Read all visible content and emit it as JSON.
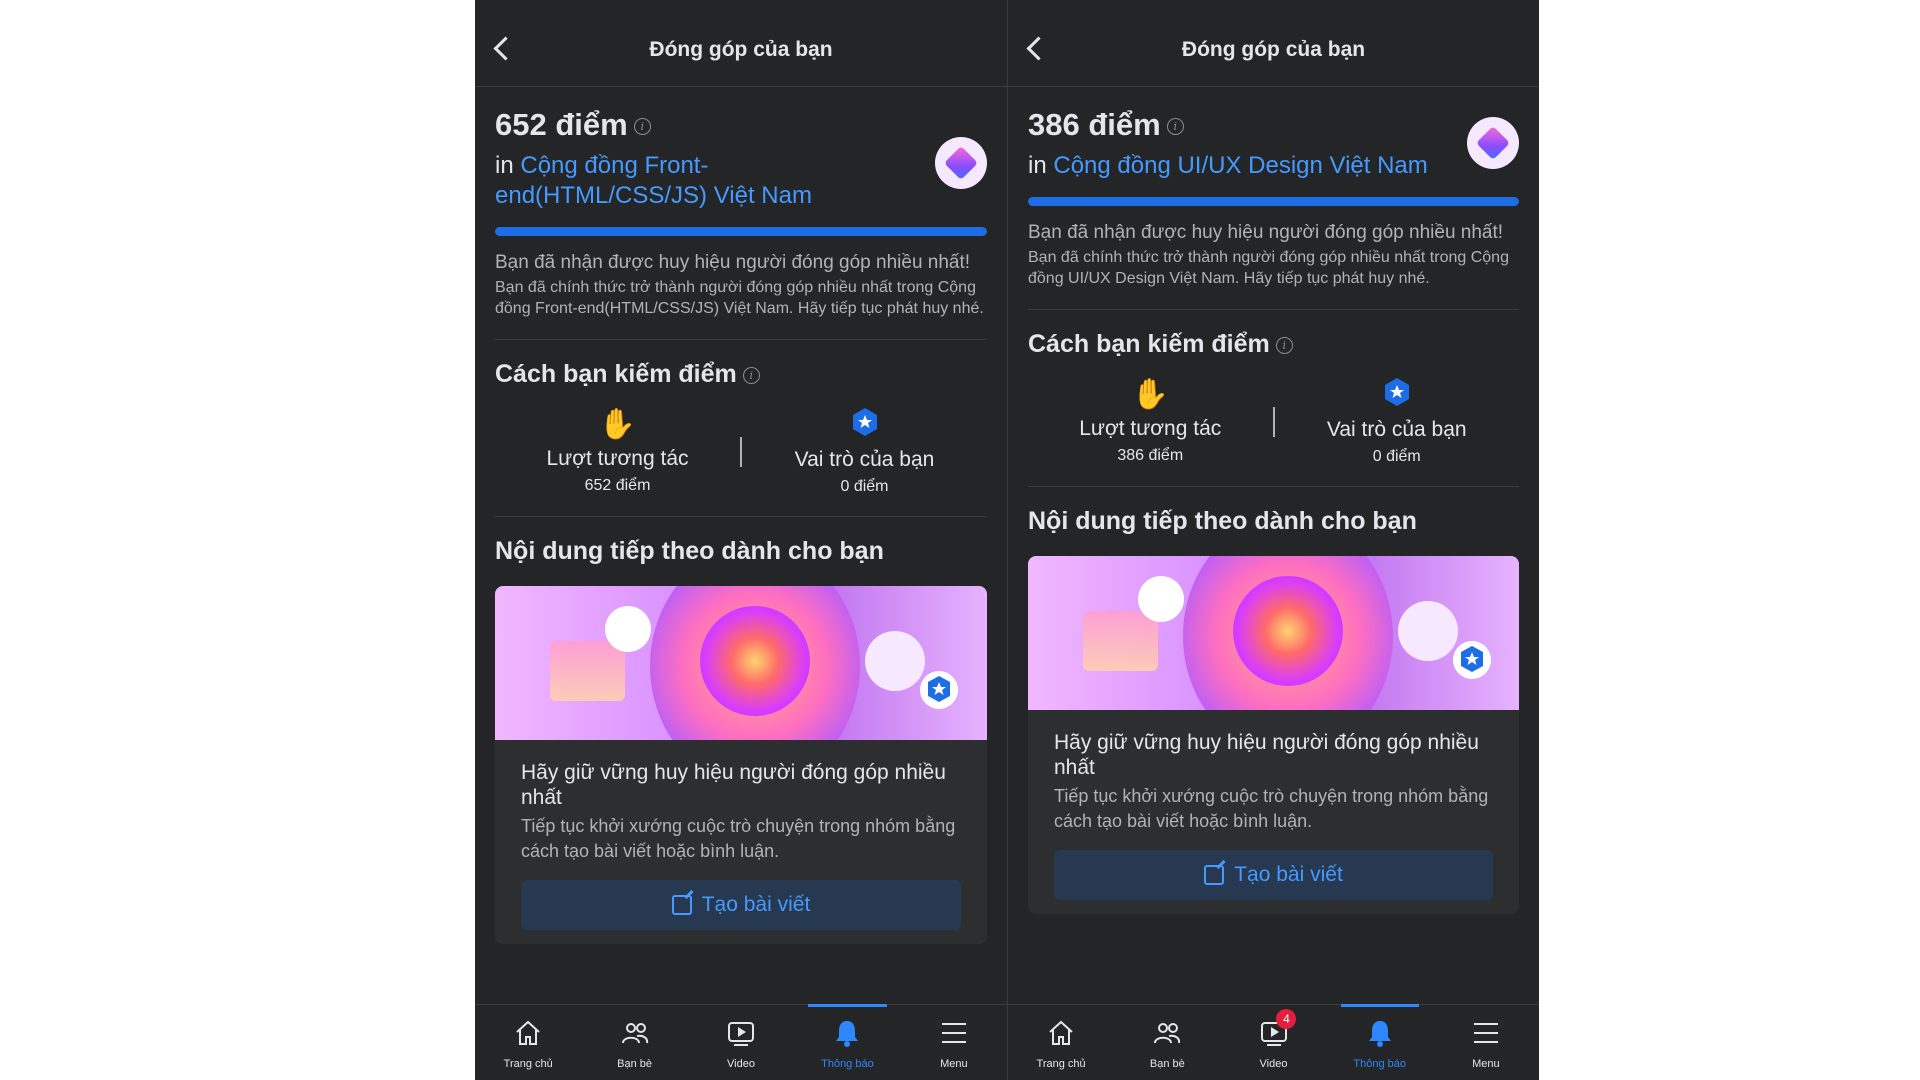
{
  "header_title": "Đóng góp của bạn",
  "in_word": "in",
  "earned_text": "Bạn đã nhận được huy hiệu người đóng góp nhiều nhất!",
  "section_earn_title": "Cách bạn kiếm điểm",
  "section_next_title": "Nội dung tiếp theo dành cho bạn",
  "stat1_label": "Lượt tương tác",
  "stat2_label": "Vai trò của bạn",
  "stat2_value": "0 điểm",
  "card_title": "Hãy giữ vững huy hiệu người đóng góp nhiều nhất",
  "card_desc": "Tiếp tục khởi xướng cuộc trò chuyện trong nhóm bằng cách tạo bài viết hoặc bình luận.",
  "create_button": "Tạo bài viết",
  "info_glyph": "i",
  "tabs": [
    "Trang chủ",
    "Bạn bè",
    "Video",
    "Thông báo",
    "Menu"
  ],
  "accent_color": "#1d6ee6",
  "link_color": "#4599ff",
  "panels": [
    {
      "score": "652 điểm",
      "community": "Cộng đồng Front-end(HTML/CSS/JS) Việt Nam",
      "official_text": "Bạn đã chính thức trở thành người đóng góp nhiều nhất trong Cộng đồng Front-end(HTML/CSS/JS) Việt Nam. Hãy tiếp tục phát huy nhé.",
      "stat1_value": "652 điểm",
      "video_badge": ""
    },
    {
      "score": "386 điểm",
      "community": "Cộng đồng UI/UX Design Việt Nam",
      "official_text": "Bạn đã chính thức trở thành người đóng góp nhiều nhất trong Cộng đồng UI/UX Design Việt Nam. Hãy tiếp tục phát huy nhé.",
      "stat1_value": "386 điểm",
      "video_badge": "4"
    }
  ]
}
